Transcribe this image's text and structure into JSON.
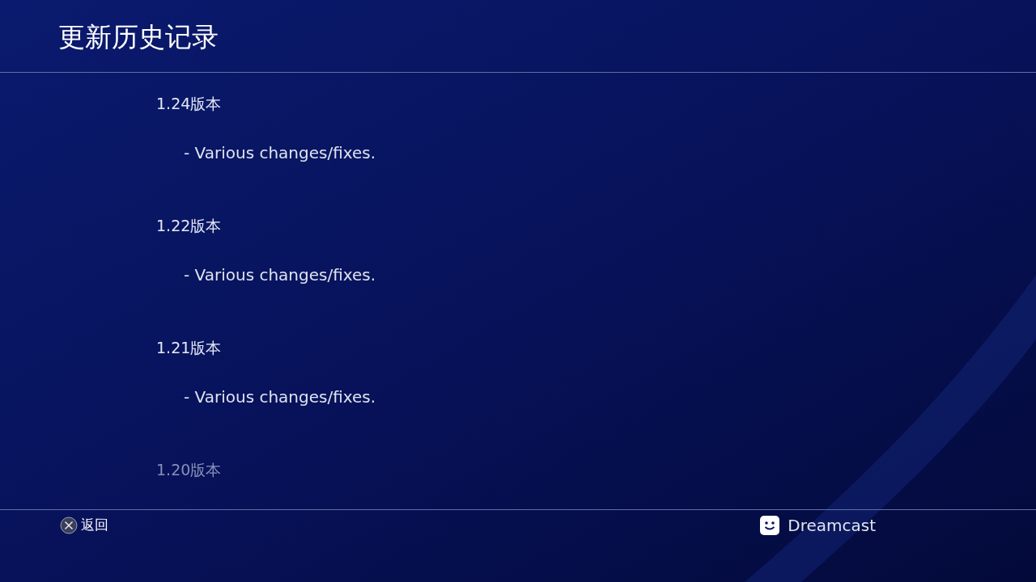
{
  "header": {
    "title": "更新历史记录"
  },
  "entries": [
    {
      "version": "1.24版本",
      "notes": [
        "- Various changes/fixes."
      ],
      "dimmed": false
    },
    {
      "version": "1.22版本",
      "notes": [
        "- Various changes/fixes."
      ],
      "dimmed": false
    },
    {
      "version": "1.21版本",
      "notes": [
        "- Various changes/fixes."
      ],
      "dimmed": false
    },
    {
      "version": "1.20版本",
      "dimmed": true
    }
  ],
  "footer": {
    "back_label": "返回",
    "user_name": "Dreamcast"
  }
}
